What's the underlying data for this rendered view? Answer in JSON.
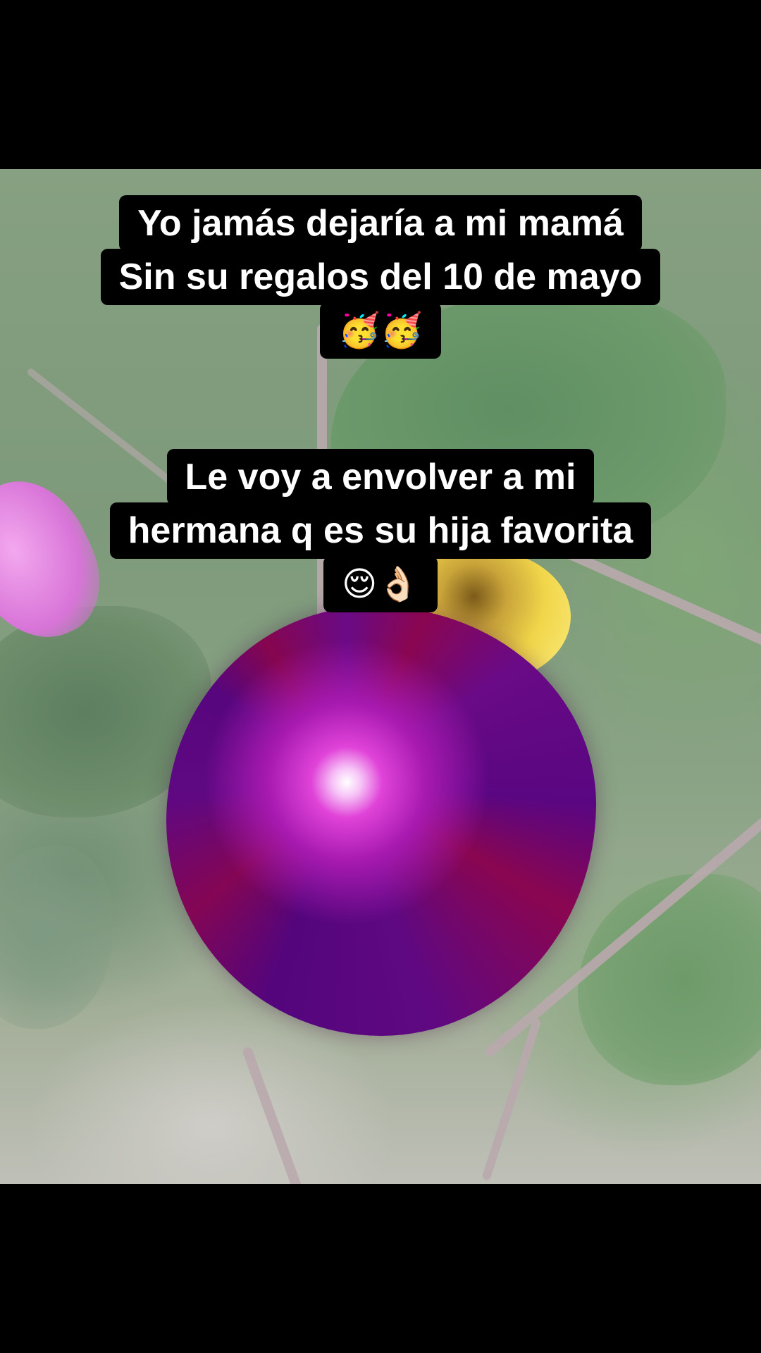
{
  "captions": [
    {
      "lines": [
        "Yo jamás dejaría a mi mamá",
        "Sin su regalos del 10 de mayo"
      ],
      "emoji": "🥳🥳"
    },
    {
      "lines": [
        "Le voy a envolver a mi",
        "hermana q es su hija favorita"
      ],
      "emoji": "😌👌🏻"
    }
  ]
}
